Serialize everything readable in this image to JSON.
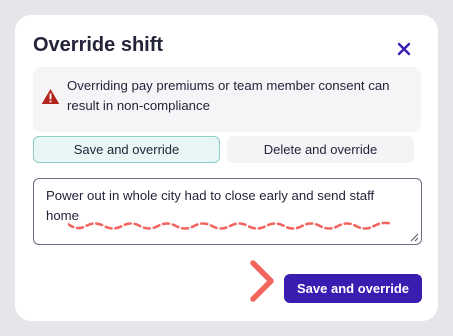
{
  "dialog": {
    "title": "Override shift",
    "close_icon": "close-icon"
  },
  "warning": {
    "icon": "warning-triangle-icon",
    "text": "Overriding pay premiums or team member consent can result in non-compliance",
    "icon_color": "#b3261e"
  },
  "options": {
    "save_label": "Save and override",
    "delete_label": "Delete and override",
    "selected": "Save and override"
  },
  "reason": {
    "value": "Power out in whole city had to close early and send staff home"
  },
  "primary_button": {
    "label": "Save and override",
    "color": "#3a1db0"
  },
  "annotation": {
    "color": "#f2665f"
  }
}
